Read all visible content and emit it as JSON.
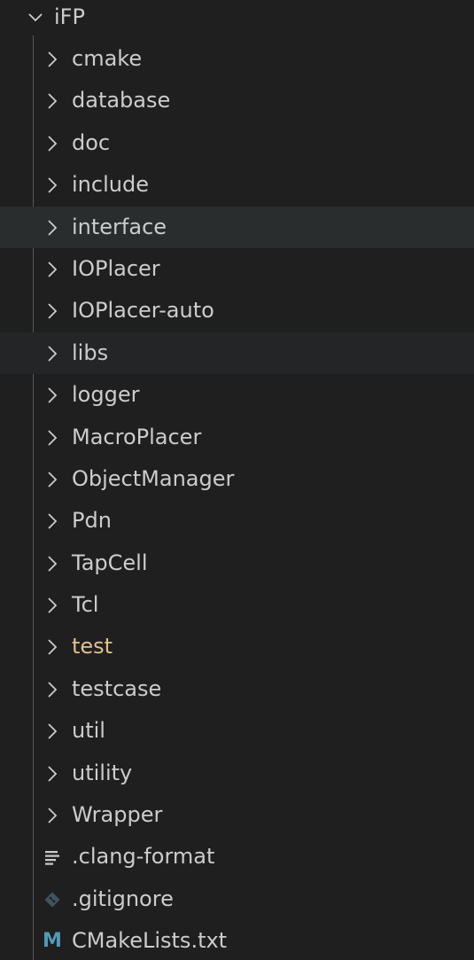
{
  "explorer": {
    "root": {
      "label": "iFP",
      "icon": "chevron-down-icon"
    },
    "items": [
      {
        "label": "cmake",
        "type": "folder",
        "icon": "chevron-right-icon"
      },
      {
        "label": "database",
        "type": "folder",
        "icon": "chevron-right-icon"
      },
      {
        "label": "doc",
        "type": "folder",
        "icon": "chevron-right-icon"
      },
      {
        "label": "include",
        "type": "folder",
        "icon": "chevron-right-icon"
      },
      {
        "label": "interface",
        "type": "folder",
        "icon": "chevron-right-icon",
        "state": "hovered"
      },
      {
        "label": "IOPlacer",
        "type": "folder",
        "icon": "chevron-right-icon"
      },
      {
        "label": "IOPlacer-auto",
        "type": "folder",
        "icon": "chevron-right-icon"
      },
      {
        "label": "libs",
        "type": "folder",
        "icon": "chevron-right-icon",
        "state": "faint"
      },
      {
        "label": "logger",
        "type": "folder",
        "icon": "chevron-right-icon"
      },
      {
        "label": "MacroPlacer",
        "type": "folder",
        "icon": "chevron-right-icon"
      },
      {
        "label": "ObjectManager",
        "type": "folder",
        "icon": "chevron-right-icon"
      },
      {
        "label": "Pdn",
        "type": "folder",
        "icon": "chevron-right-icon"
      },
      {
        "label": "TapCell",
        "type": "folder",
        "icon": "chevron-right-icon"
      },
      {
        "label": "Tcl",
        "type": "folder",
        "icon": "chevron-right-icon"
      },
      {
        "label": "test",
        "type": "folder",
        "icon": "chevron-right-icon",
        "color": "#e2c08d"
      },
      {
        "label": "testcase",
        "type": "folder",
        "icon": "chevron-right-icon"
      },
      {
        "label": "util",
        "type": "folder",
        "icon": "chevron-right-icon"
      },
      {
        "label": "utility",
        "type": "folder",
        "icon": "chevron-right-icon"
      },
      {
        "label": "Wrapper",
        "type": "folder",
        "icon": "chevron-right-icon"
      },
      {
        "label": ".clang-format",
        "type": "file",
        "icon": "lines-file-icon"
      },
      {
        "label": ".gitignore",
        "type": "file",
        "icon": "git-icon"
      },
      {
        "label": "CMakeLists.txt",
        "type": "file",
        "icon": "cmake-m-icon",
        "icon_text": "M"
      }
    ]
  },
  "colors": {
    "background": "#1f1f1f",
    "text": "#cccccc",
    "hover_row": "#2a2d2e",
    "modified_folder": "#e2c08d",
    "cmake_icon": "#519aba",
    "git_icon": "#41535b"
  }
}
